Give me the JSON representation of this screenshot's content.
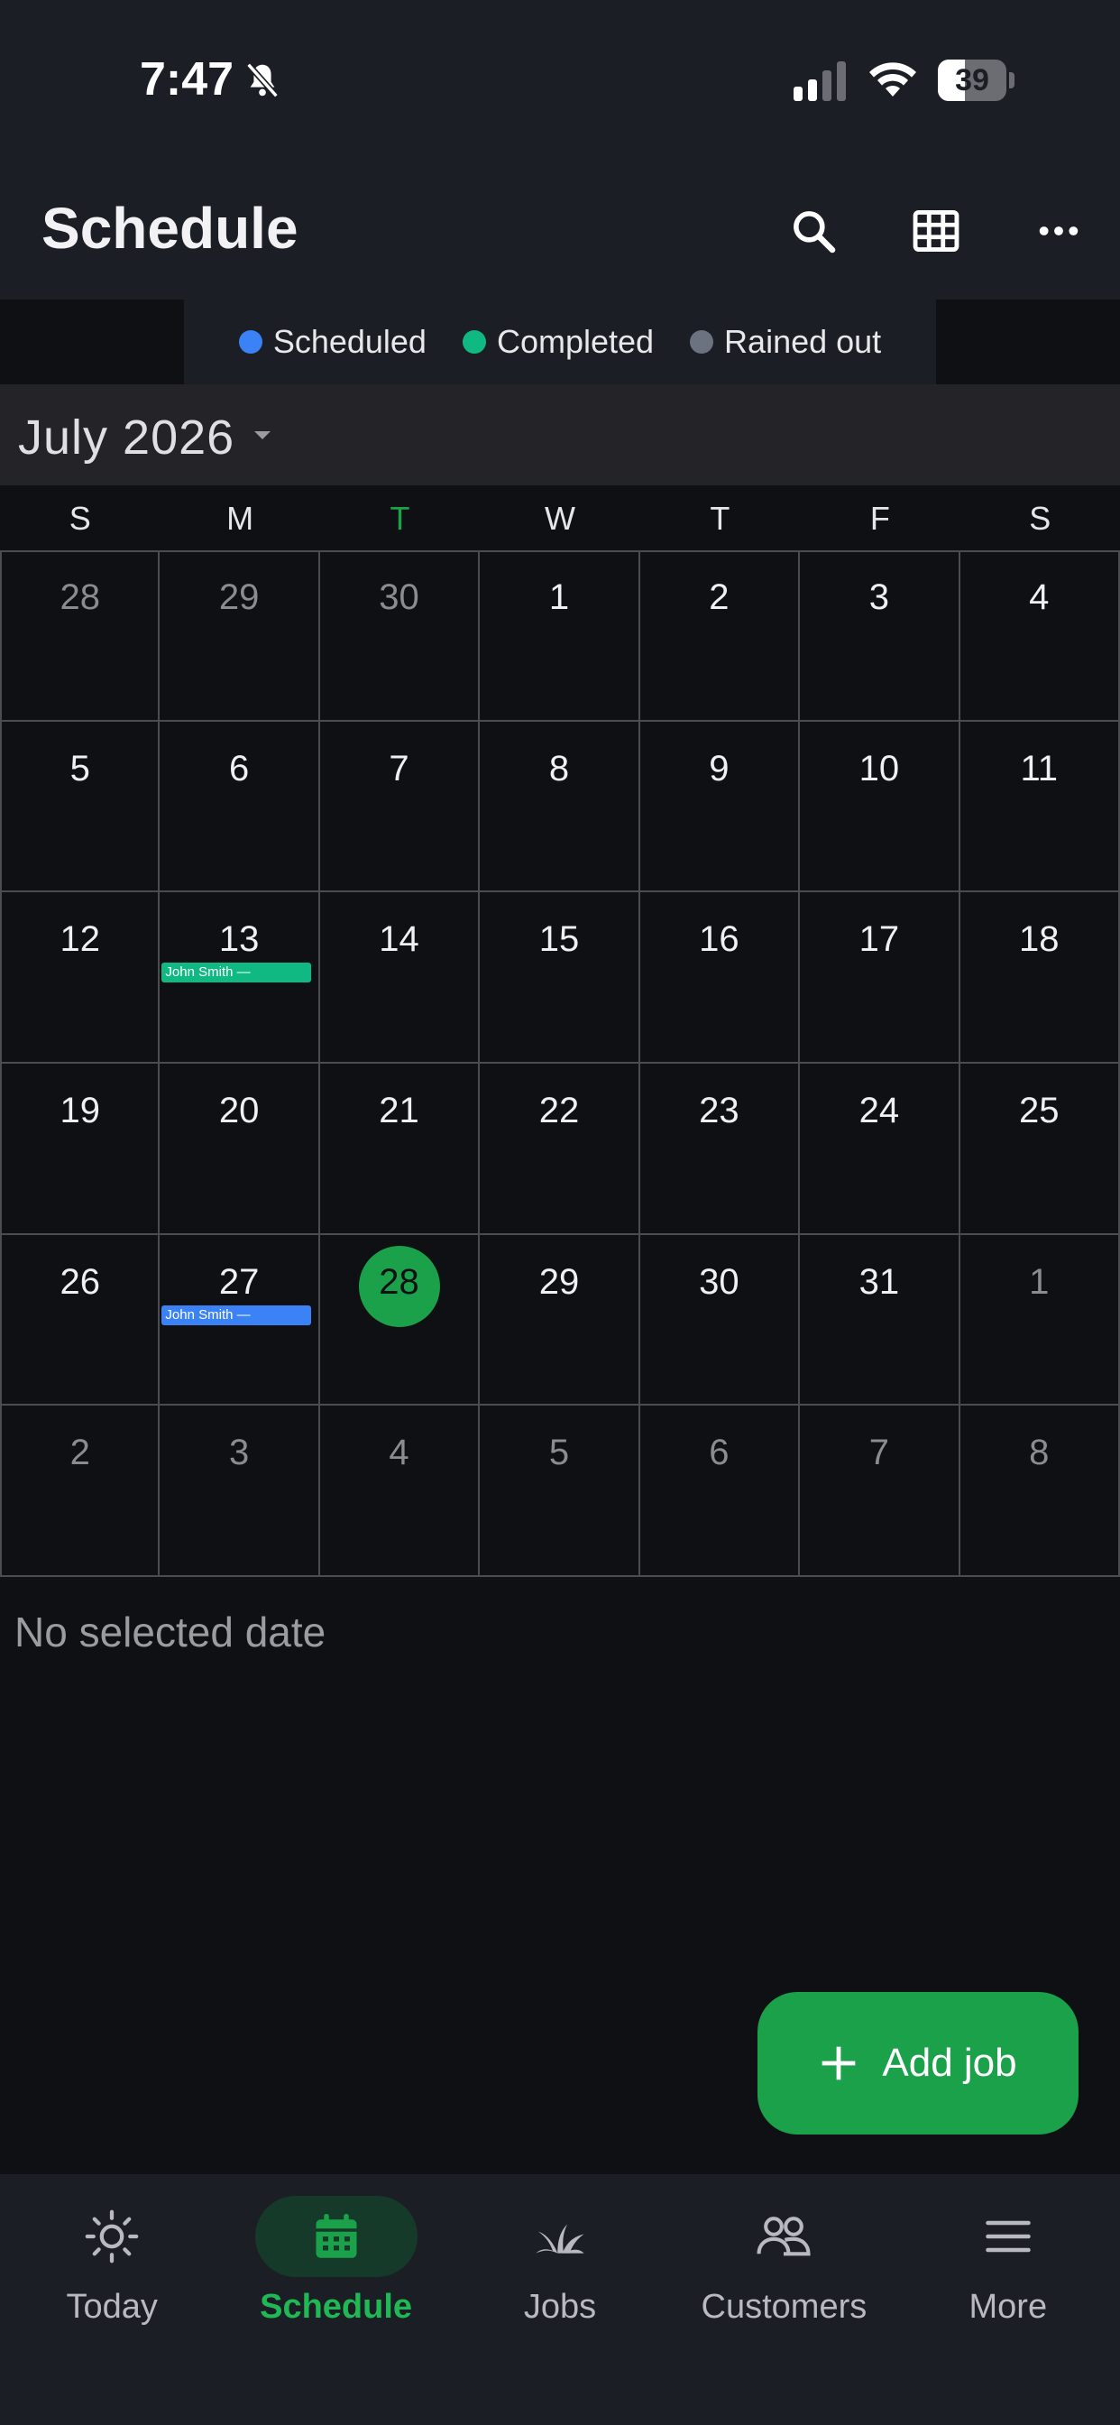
{
  "status_bar": {
    "time": "7:47",
    "battery": "39",
    "battery_level": 0.39
  },
  "header": {
    "title": "Schedule"
  },
  "legend": [
    {
      "label": "Scheduled",
      "color": "#3b82f6"
    },
    {
      "label": "Completed",
      "color": "#10b981"
    },
    {
      "label": "Rained out",
      "color": "#6b7280"
    }
  ],
  "calendar": {
    "month_label": "July 2026",
    "weekdays": [
      "S",
      "M",
      "T",
      "W",
      "T",
      "F",
      "S"
    ],
    "current_weekday_color": "#1aa14a",
    "weeks": [
      [
        {
          "d": "28",
          "other": true
        },
        {
          "d": "29",
          "other": true
        },
        {
          "d": "30",
          "other": true
        },
        {
          "d": "1"
        },
        {
          "d": "2"
        },
        {
          "d": "3"
        },
        {
          "d": "4"
        }
      ],
      [
        {
          "d": "5"
        },
        {
          "d": "6"
        },
        {
          "d": "7"
        },
        {
          "d": "8"
        },
        {
          "d": "9"
        },
        {
          "d": "10"
        },
        {
          "d": "11"
        }
      ],
      [
        {
          "d": "12"
        },
        {
          "d": "13",
          "event": {
            "label": "John Smith —",
            "status": "completed"
          }
        },
        {
          "d": "14"
        },
        {
          "d": "15"
        },
        {
          "d": "16"
        },
        {
          "d": "17"
        },
        {
          "d": "18"
        }
      ],
      [
        {
          "d": "19"
        },
        {
          "d": "20"
        },
        {
          "d": "21"
        },
        {
          "d": "22"
        },
        {
          "d": "23"
        },
        {
          "d": "24"
        },
        {
          "d": "25"
        }
      ],
      [
        {
          "d": "26"
        },
        {
          "d": "27",
          "event": {
            "label": "John Smith —",
            "status": "scheduled"
          }
        },
        {
          "d": "28",
          "today": true
        },
        {
          "d": "29"
        },
        {
          "d": "30"
        },
        {
          "d": "31"
        },
        {
          "d": "1",
          "other": true
        }
      ],
      [
        {
          "d": "2",
          "other": true
        },
        {
          "d": "3",
          "other": true
        },
        {
          "d": "4",
          "other": true
        },
        {
          "d": "5",
          "other": true
        },
        {
          "d": "6",
          "other": true
        },
        {
          "d": "7",
          "other": true
        },
        {
          "d": "8",
          "other": true
        }
      ]
    ]
  },
  "selection": {
    "empty_text": "No selected date"
  },
  "fab": {
    "label": "Add job",
    "icon": "plus-icon"
  },
  "bottom_nav": [
    {
      "label": "Today",
      "icon": "sun-icon",
      "active": false
    },
    {
      "label": "Schedule",
      "icon": "calendar-icon",
      "active": true
    },
    {
      "label": "Jobs",
      "icon": "grass-icon",
      "active": false
    },
    {
      "label": "Customers",
      "icon": "people-icon",
      "active": false
    },
    {
      "label": "More",
      "icon": "menu-icon",
      "active": false
    }
  ],
  "colors": {
    "accent": "#1aa14a",
    "scheduled": "#3b82f6",
    "completed": "#10b981"
  }
}
